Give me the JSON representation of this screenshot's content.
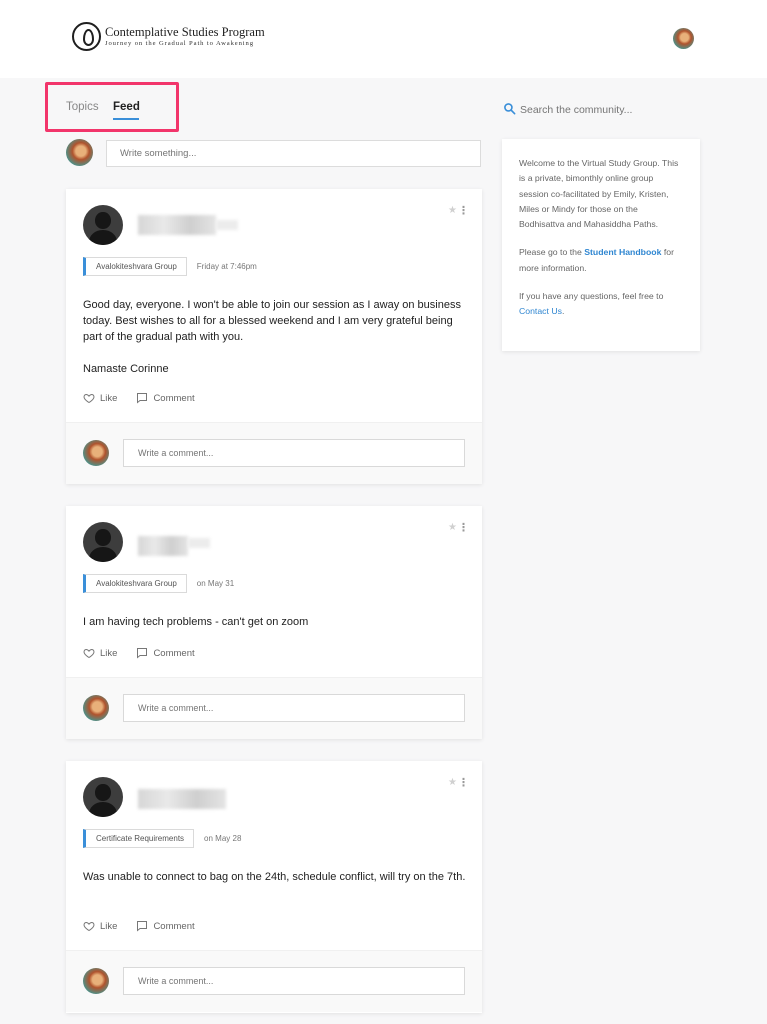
{
  "header": {
    "logo_title": "Contemplative Studies Program",
    "logo_subtitle": "Journey on the Gradual Path to Awakening"
  },
  "tabs": [
    {
      "label": "Topics",
      "active": false
    },
    {
      "label": "Feed",
      "active": true
    }
  ],
  "composer": {
    "placeholder": "Write something..."
  },
  "search": {
    "placeholder": "Search the community..."
  },
  "about": {
    "intro": "Welcome to the Virtual Study Group. This is a private, bimonthly online group session co-facilitated by Emily, Kristen, Miles or Mindy for those on the Bodhisattva and Mahasiddha Paths.",
    "handbook_prefix": "Please go to the ",
    "handbook_link": "Student Handbook",
    "handbook_suffix": " for more information.",
    "questions_prefix": "If you have any questions, feel free to ",
    "contact_link": "Contact Us",
    "questions_suffix": "."
  },
  "posts": [
    {
      "group": "Avalokiteshvara Group",
      "time": "Friday at 7:46pm",
      "body_1": "Good day, everyone.  I won't be able to join our session as I away on business today.  Best wishes to all for a blessed weekend and I am very grateful being part of the gradual path with you.",
      "body_2": "Namaste Corinne",
      "like_label": "Like",
      "comment_label": "Comment",
      "comment_placeholder": "Write a comment..."
    },
    {
      "group": "Avalokiteshvara Group",
      "time": "on May 31",
      "body_1": "I am having tech problems - can't get on zoom",
      "like_label": "Like",
      "comment_label": "Comment",
      "comment_placeholder": "Write a comment..."
    },
    {
      "group": "Certificate Requirements",
      "time": "on May 28",
      "body_1": "Was unable to connect to bag on the 24th, schedule conflict, will try on the 7th.",
      "like_label": "Like",
      "comment_label": "Comment",
      "comment_placeholder": "Write a comment..."
    }
  ],
  "colors": {
    "accent": "#3a8fd9",
    "highlight": "#f2356b",
    "link": "#2f86d1"
  }
}
